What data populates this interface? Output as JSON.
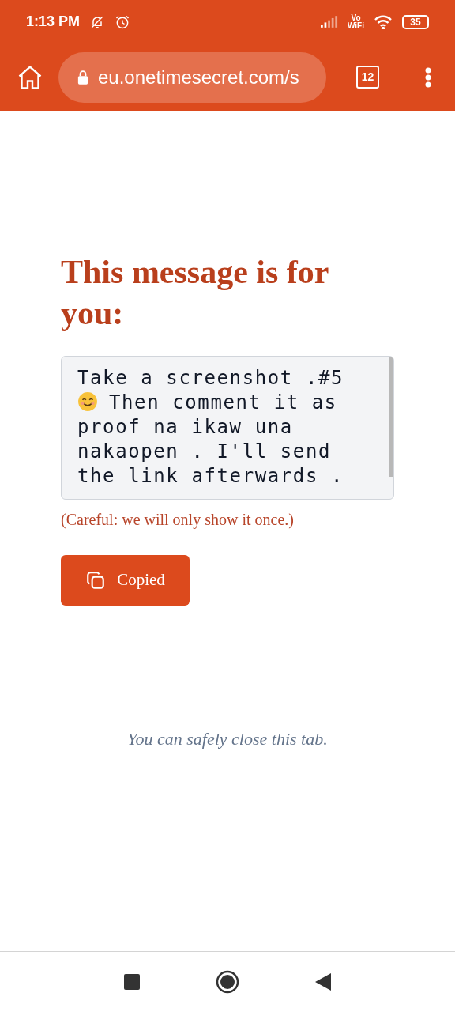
{
  "status_bar": {
    "time": "1:13 PM",
    "network_label": "Vo\nWiFi",
    "battery": "35"
  },
  "browser": {
    "url": "eu.onetimesecret.com/s",
    "tab_count": "12"
  },
  "heading": "This message is for you:",
  "message": {
    "lines": [
      {
        "text": "Take a screenshot .#5",
        "emoji": false
      },
      {
        "text": "Then comment it as",
        "emoji": true
      },
      {
        "text": "proof na ikaw una",
        "emoji": false
      },
      {
        "text": "nakaopen . I'll send",
        "emoji": false
      },
      {
        "text": "the link afterwards .",
        "emoji": false
      }
    ]
  },
  "warning": "(Careful: we will only show it once.)",
  "copy_button": {
    "label": "Copied"
  },
  "footer_note": "You can safely close this tab."
}
